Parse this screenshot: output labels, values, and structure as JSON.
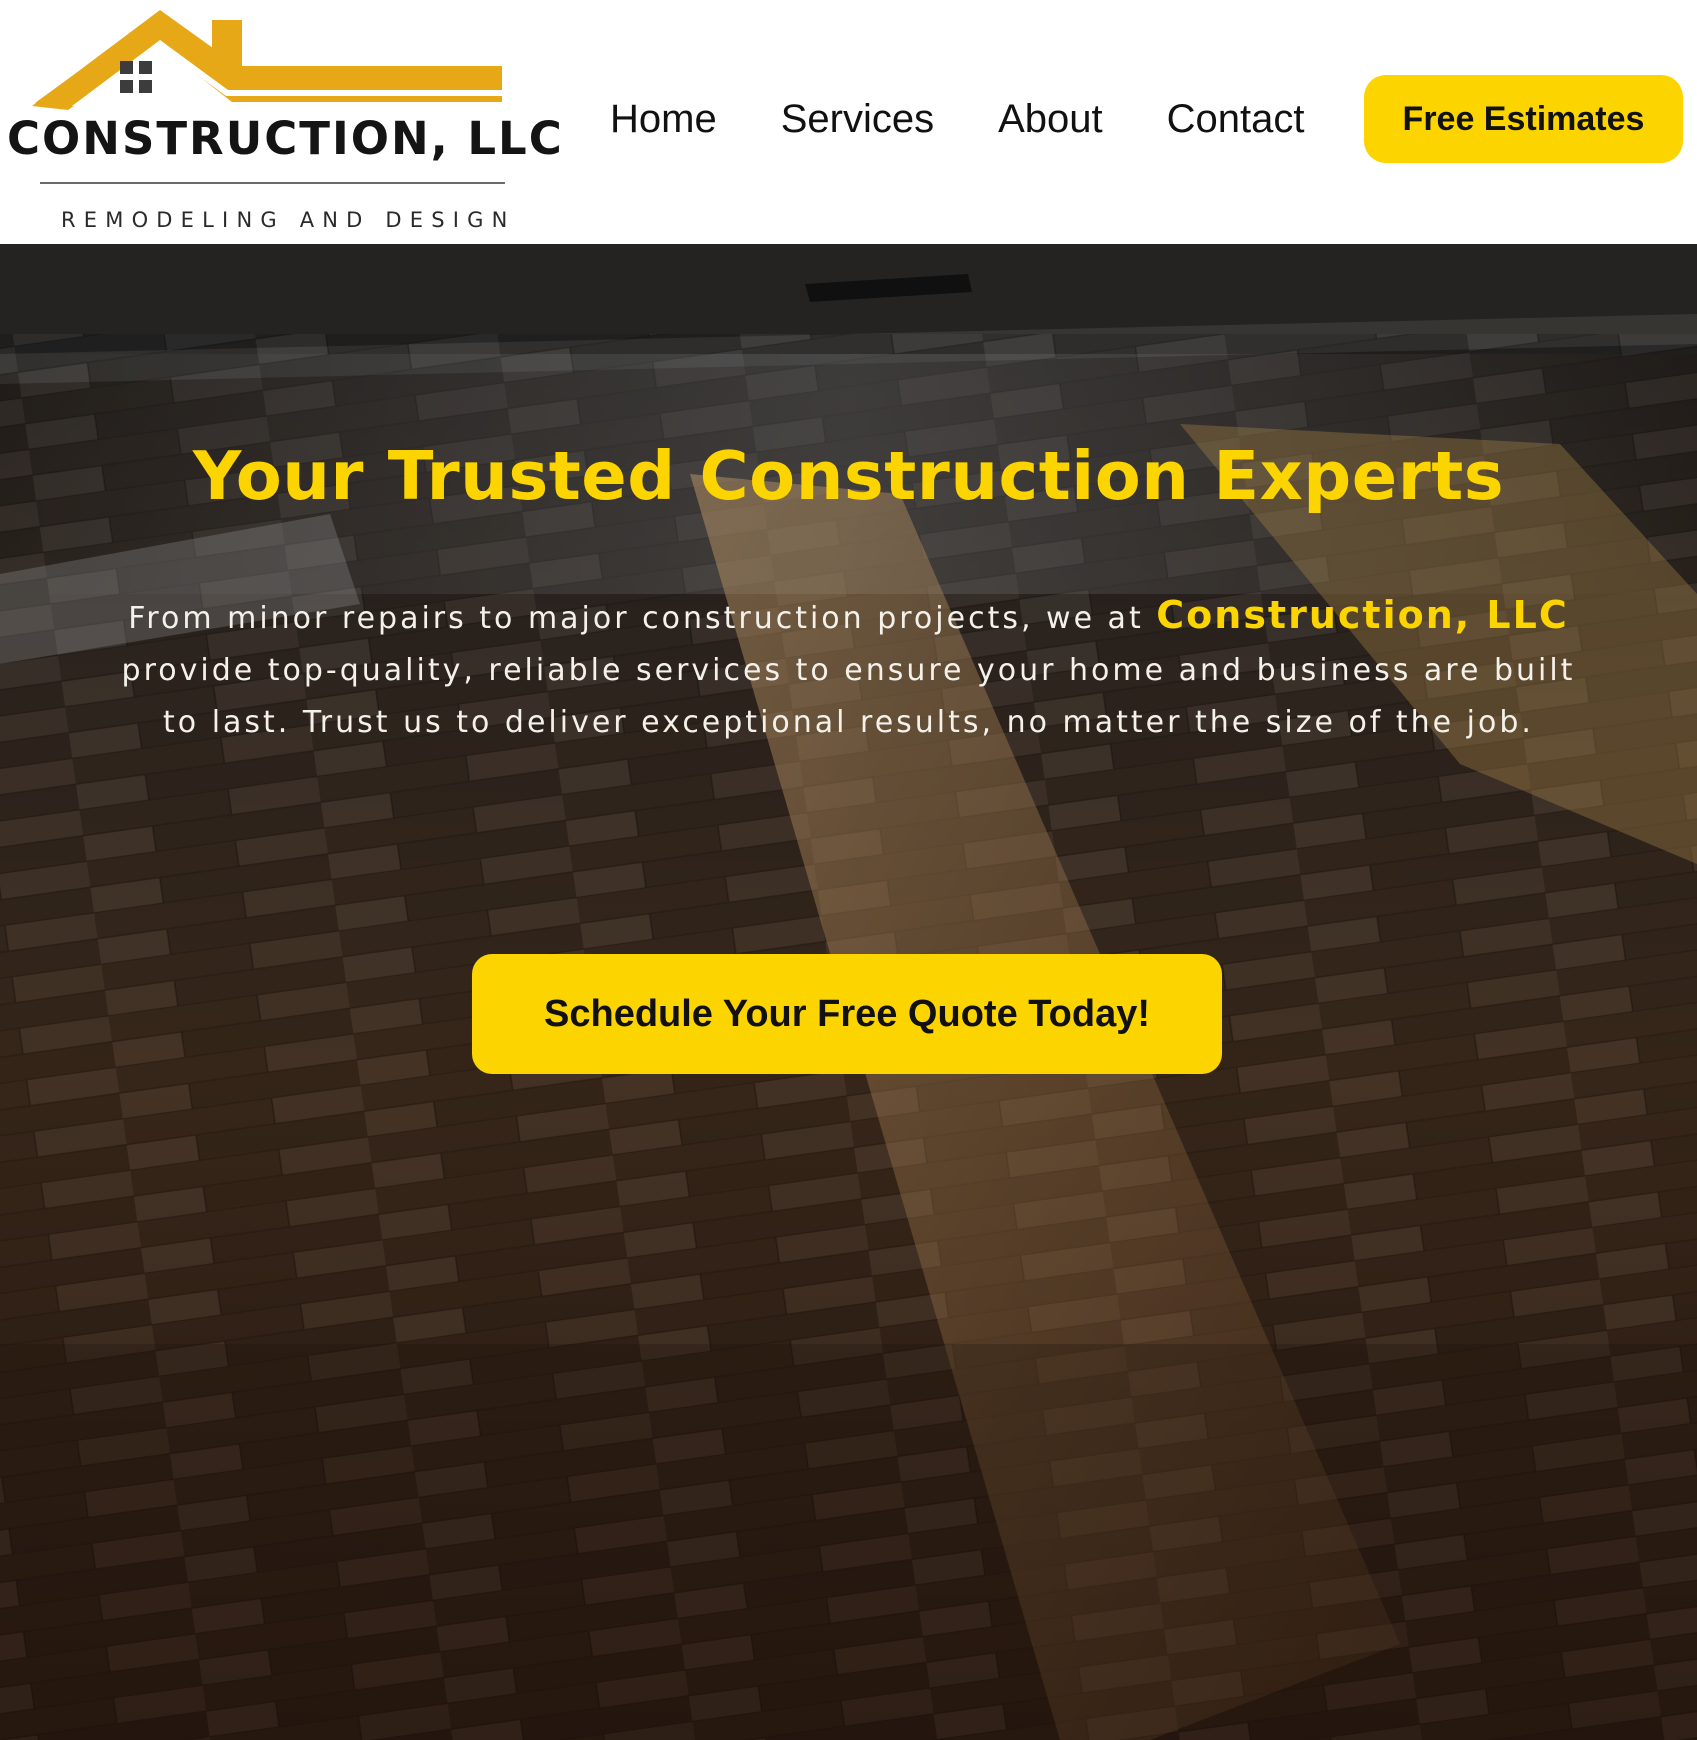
{
  "logo": {
    "wordmark": "CONSTRUCTION, LLC",
    "tagline": "REMODELING AND DESIGN",
    "roof_color": "#e6a817",
    "window_color": "#3c3c3c"
  },
  "nav": {
    "items": [
      {
        "label": "Home"
      },
      {
        "label": "Services"
      },
      {
        "label": "About"
      },
      {
        "label": "Contact"
      }
    ]
  },
  "header_cta": {
    "label": "Free Estimates"
  },
  "hero": {
    "title": "Your Trusted Construction Experts",
    "description_before": "From minor repairs to major construction projects, we at",
    "description_brand": "Construction, LLC",
    "description_after": "provide top-quality, reliable services to ensure your home and business are built to last. Trust us to deliver exceptional results, no matter the size of the job.",
    "cta_label": "Schedule Your Free Quote Today!",
    "background": "hardwood-floor-photo"
  },
  "colors": {
    "accent": "#fcd400",
    "header_bg": "#ffffff",
    "text_dark": "#111111",
    "hero_text": "#f4f1ea"
  }
}
